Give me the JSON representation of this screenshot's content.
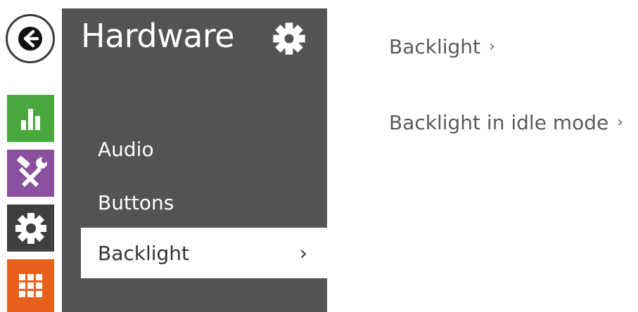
{
  "app": {
    "back_icon": "arrow-left-icon"
  },
  "rail": {
    "items": [
      {
        "name": "status",
        "icon": "bar-chart-icon",
        "color": "#49a83d"
      },
      {
        "name": "services",
        "icon": "tools-icon",
        "color": "#8a4f9f"
      },
      {
        "name": "hardware",
        "icon": "gear-icon",
        "color": "#3f3f3f"
      },
      {
        "name": "system",
        "icon": "grid-icon",
        "color": "#e8601c"
      }
    ]
  },
  "menu": {
    "title": "Hardware",
    "title_icon": "gear-icon",
    "background": "#535353",
    "items": [
      {
        "label": "Audio"
      },
      {
        "label": "Buttons"
      },
      {
        "label": "Backlight",
        "active": true,
        "chevron": "›"
      }
    ]
  },
  "content": {
    "sections": [
      {
        "label": "Backlight",
        "chevron": "›"
      },
      {
        "label": "Backlight in idle mode",
        "chevron": "›"
      }
    ]
  }
}
